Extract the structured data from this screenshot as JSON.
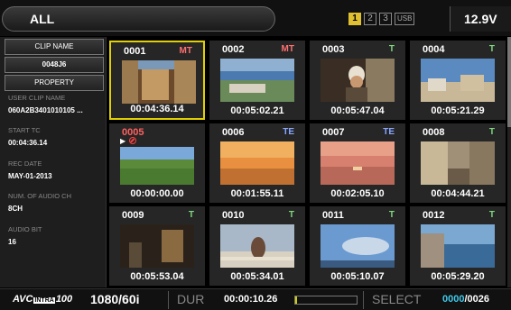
{
  "header": {
    "filter_label": "ALL",
    "slots": [
      "1",
      "2",
      "3",
      "USB"
    ],
    "active_slot": "1",
    "voltage": "12.9V"
  },
  "panel": {
    "clip_name_button": "CLIP NAME",
    "clip_name_value": "0048J6",
    "property_button": "PROPERTY",
    "user_clip_name_label": "USER CLIP NAME",
    "user_clip_name_value": "060A2B3401010105 ...",
    "start_tc_label": "START TC",
    "start_tc_value": "00:04:36.14",
    "rec_date_label": "REC DATE",
    "rec_date_value": "MAY-01-2013",
    "audio_ch_label": "NUM. OF AUDIO CH",
    "audio_ch_value": "8CH",
    "audio_bit_label": "AUDIO BIT",
    "audio_bit_value": "16"
  },
  "clips": [
    {
      "num": "0001",
      "badge": "MT",
      "badge_color": "red",
      "tc": "00:04:36.14",
      "num_color": "white",
      "selected": true,
      "scene": "street"
    },
    {
      "num": "0002",
      "badge": "MT",
      "badge_color": "red",
      "tc": "00:05:02.21",
      "num_color": "white",
      "scene": "coast"
    },
    {
      "num": "0003",
      "badge": "T",
      "badge_color": "green",
      "tc": "00:05:47.04",
      "num_color": "white",
      "scene": "portrait"
    },
    {
      "num": "0004",
      "badge": "T",
      "badge_color": "green",
      "tc": "00:05:21.29",
      "num_color": "white",
      "scene": "sky-town"
    },
    {
      "num": "0005",
      "badge": "",
      "badge_color": "red",
      "tc": "00:00:00.00",
      "num_color": "red",
      "scene": "field",
      "marker": true
    },
    {
      "num": "0006",
      "badge": "TE",
      "badge_color": "blue",
      "tc": "00:01:55.11",
      "num_color": "white",
      "scene": "sunset"
    },
    {
      "num": "0007",
      "badge": "TE",
      "badge_color": "blue",
      "tc": "00:02:05.10",
      "num_color": "white",
      "scene": "dusk-sea"
    },
    {
      "num": "0008",
      "badge": "T",
      "badge_color": "green",
      "tc": "00:04:44.21",
      "num_color": "white",
      "scene": "alley"
    },
    {
      "num": "0009",
      "badge": "T",
      "badge_color": "green",
      "tc": "00:05:53.04",
      "num_color": "white",
      "scene": "dark-room"
    },
    {
      "num": "0010",
      "badge": "T",
      "badge_color": "green",
      "tc": "00:05:34.01",
      "num_color": "white",
      "scene": "terrace"
    },
    {
      "num": "0011",
      "badge": "T",
      "badge_color": "green",
      "tc": "00:05:10.07",
      "num_color": "white",
      "scene": "sky"
    },
    {
      "num": "0012",
      "badge": "T",
      "badge_color": "green",
      "tc": "00:05:29.20",
      "num_color": "white",
      "scene": "sea-cliff"
    }
  ],
  "footer": {
    "codec_pre": "AVC",
    "codec_intra": "INTRA",
    "codec_post": "100",
    "format": "1080/60i",
    "dur_label": "DUR",
    "dur_value": "00:00:10.26",
    "progress": 0.03,
    "select_label": "SELECT",
    "select_current": "0000",
    "select_total": "/0026"
  },
  "colors": {
    "selection": "#e0d000",
    "accent_cyan": "#40c8e8",
    "slot_active": "#e0c030"
  }
}
